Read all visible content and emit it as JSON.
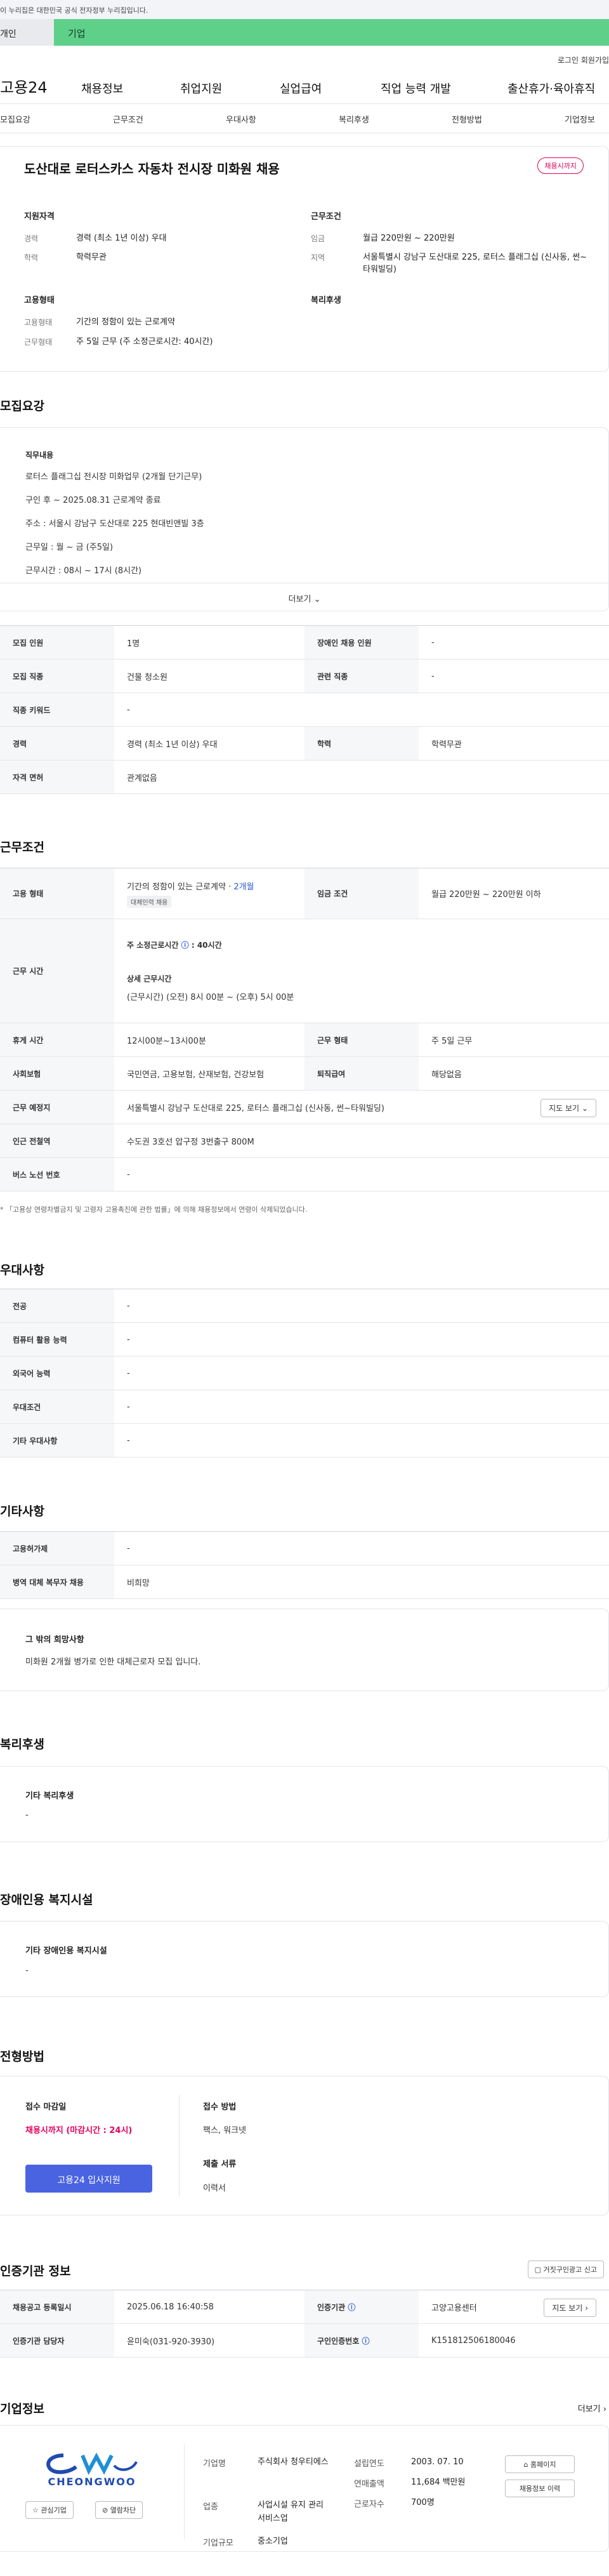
{
  "govbar": {
    "text": "이 누리집은 대한민국 공식 전자정부 누리집입니다."
  },
  "category": {
    "left": "개인",
    "right": "기업"
  },
  "util": {
    "login": "로그인",
    "join": "회원가입"
  },
  "gnb": {
    "logo": "고용24",
    "menus": [
      "채용정보",
      "취업지원",
      "실업급여",
      "직업 능력 개발",
      "출산휴가·육아휴직"
    ]
  },
  "tabs": [
    "모집요강",
    "근무조건",
    "우대사항",
    "복리후생",
    "전형방법",
    "기업정보"
  ],
  "summary": {
    "title": "도산대로 로터스카스 자동차 전시장 미화원 채용",
    "status": "채용시까지",
    "qual_title": "지원자격",
    "career_label": "경력",
    "career_val": "경력 (최소 1년 이상) 우대",
    "edu_label": "학력",
    "edu_val": "학력무관",
    "work_title": "근무조건",
    "wage_label": "임금",
    "wage_val": "월급 220만원 ~ 220만원",
    "region_label": "지역",
    "region_val": "서울특별시 강남구 도산대로 225, 로터스 플래그십 (신사동, 썬~타워빌딩)",
    "emp_title": "고용형태",
    "emp_label": "고용형태",
    "emp_val": "기간의 정함이 있는 근로계약",
    "shift_label": "근무형태",
    "shift_val": "주 5일 근무 (주 소정근로시간: 40시간)",
    "welfare_title": "복리후생"
  },
  "recruit": {
    "section_title": "모집요강",
    "desc_title": "직무내용",
    "desc_lines": [
      "로터스 플래그십 전시장 미화업무 (2개월 단기근무)",
      "구인 후 ~ 2025.08.31 근로계약 종료",
      "주소 : 서울시 강남구 도산대로 225 현대빈앤빌 3층",
      "근무일 : 월 ~ 금 (주5일)",
      "근무시간 : 08시 ~ 17시 (8시간)"
    ],
    "more": "더보기",
    "rows": [
      {
        "th1": "모집 인원",
        "td1": "1명",
        "th2": "장애인 채용 인원",
        "td2": "-"
      },
      {
        "th1": "모집 직종",
        "td1": "건물 청소원",
        "th2": "관련 직종",
        "td2": "-"
      },
      {
        "th1": "직종 키워드",
        "td1": "-"
      },
      {
        "th1": "경력",
        "td1": "경력 (최소 1년 이상) 우대",
        "th2": "학력",
        "td2": "학력무관"
      },
      {
        "th1": "자격 면허",
        "td1": "관계없음"
      }
    ]
  },
  "work": {
    "section_title": "근무조건",
    "emp_th": "고용 형태",
    "emp_td": "기간의 정함이 있는 근로계약 · ",
    "emp_period": "2개월",
    "emp_chip": "대체인력 채용",
    "wage_th": "임금 조건",
    "wage_td": "월급 220만원 ~ 220만원 이하",
    "hours_th": "근무 시간",
    "hours_weekly": "주 소정근로시간",
    "hours_weekly_val": ": 40시간",
    "hours_detail_title": "상세 근무시간",
    "hours_detail": "(근무시간) (오전) 8시 00분 ~ (오후) 5시 00분",
    "break_th": "휴게 시간",
    "break_td": "12시00분~13시00분",
    "shift_th": "근무 형태",
    "shift_td": "주 5일 근무",
    "ins_th": "사회보험",
    "ins_td": "국민연금, 고용보험, 산재보험, 건강보험",
    "sev_th": "퇴직급여",
    "sev_td": "해당없음",
    "place_th": "근무 예정지",
    "place_td": "서울특별시 강남구 도산대로 225, 로터스 플래그십 (신사동, 썬~타워빌딩)",
    "map_btn": "지도 보기",
    "station_th": "인근 전철역",
    "station_td": "수도권 3호선 압구정 3번출구 800M",
    "bus_th": "버스 노선 번호",
    "bus_td": "-",
    "note": "* 「고용상 연령차별금지 및 고령자 고용촉진에 관한 법률」에 의해 채용정보에서 연령이 삭제되었습니다."
  },
  "pref": {
    "section_title": "우대사항",
    "rows": [
      {
        "th": "전공",
        "td": "-"
      },
      {
        "th": "컴퓨터 활용 능력",
        "td": "-"
      },
      {
        "th": "외국어 능력",
        "td": "-"
      },
      {
        "th": "우대조건",
        "td": "-"
      },
      {
        "th": "기타 우대사항",
        "td": "-"
      }
    ]
  },
  "etc": {
    "section_title": "기타사항",
    "rows": [
      {
        "th": "고용허가제",
        "td": "-"
      },
      {
        "th": "병역 대체 복무자 채용",
        "td": "비희망"
      }
    ],
    "wish_title": "그 밖의 희망사항",
    "wish_text": "미화원 2개월 병가로 인한 대체근로자 모집 입니다."
  },
  "welfare": {
    "section_title": "복리후생",
    "box_title": "기타 복리후생",
    "box_text": "-"
  },
  "disabled": {
    "section_title": "장애인용 복지시설",
    "box_title": "기타 장애인용 복지시설",
    "box_text": "-"
  },
  "screening": {
    "section_title": "전형방법",
    "deadline_title": "접수 마감일",
    "deadline_val": "채용시까지 (마감시간 : 24시)",
    "apply_btn": "고용24 입사지원",
    "method_title": "접수 방법",
    "method_val": "팩스, 워크넷",
    "docs_title": "제출 서류",
    "docs_val": "이력서"
  },
  "cert": {
    "section_title": "인증기관 정보",
    "report_btn": "거짓구인광고 신고",
    "reg_th": "채용공고 등록일시",
    "reg_td": "2025.06.18 16:40:58",
    "org_th": "인증기관",
    "org_td": "고양고용센터",
    "map_btn": "지도 보기",
    "mgr_th": "인증기관 담당자",
    "mgr_td": "윤미숙(031-920-3930)",
    "num_th": "구인인증번호",
    "num_td": "K151812506180046"
  },
  "company": {
    "section_title": "기업정보",
    "more": "더보기",
    "logo_text": "CHEONGWOO",
    "interest_btn": "관심기업",
    "block_btn": "열람차단",
    "name_label": "기업명",
    "name_val": "주식회사 청우티에스",
    "biz_label": "업종",
    "biz_val": "사업시설 유지 관리 서비스업",
    "size_label": "기업규모",
    "size_val": "중소기업",
    "found_label": "설립연도",
    "found_val": "2003. 07. 10",
    "sales_label": "연매출액",
    "sales_val": "11,684 백만원",
    "emp_label": "근로자수",
    "emp_val": "700명",
    "home_btn": "홈페이지",
    "jobs_btn": "채용정보 이력"
  },
  "colors": {
    "accent": "#4a63e0",
    "status": "#e2005a",
    "category": "#5fd08a"
  }
}
